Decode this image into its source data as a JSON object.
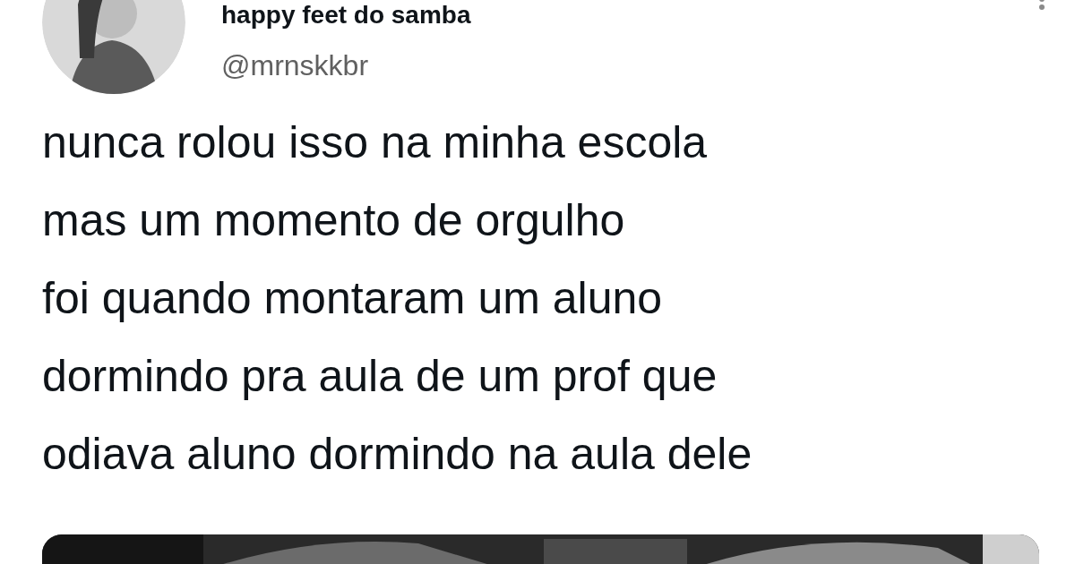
{
  "author": {
    "name": "happy feet do samba",
    "handle": "@mrnskkbr"
  },
  "text_lines": [
    "nunca rolou isso na minha escola",
    "mas um momento de orgulho",
    "foi quando montaram um aluno",
    "dormindo pra aula de um prof que",
    "odiava aluno dormindo na aula dele"
  ]
}
